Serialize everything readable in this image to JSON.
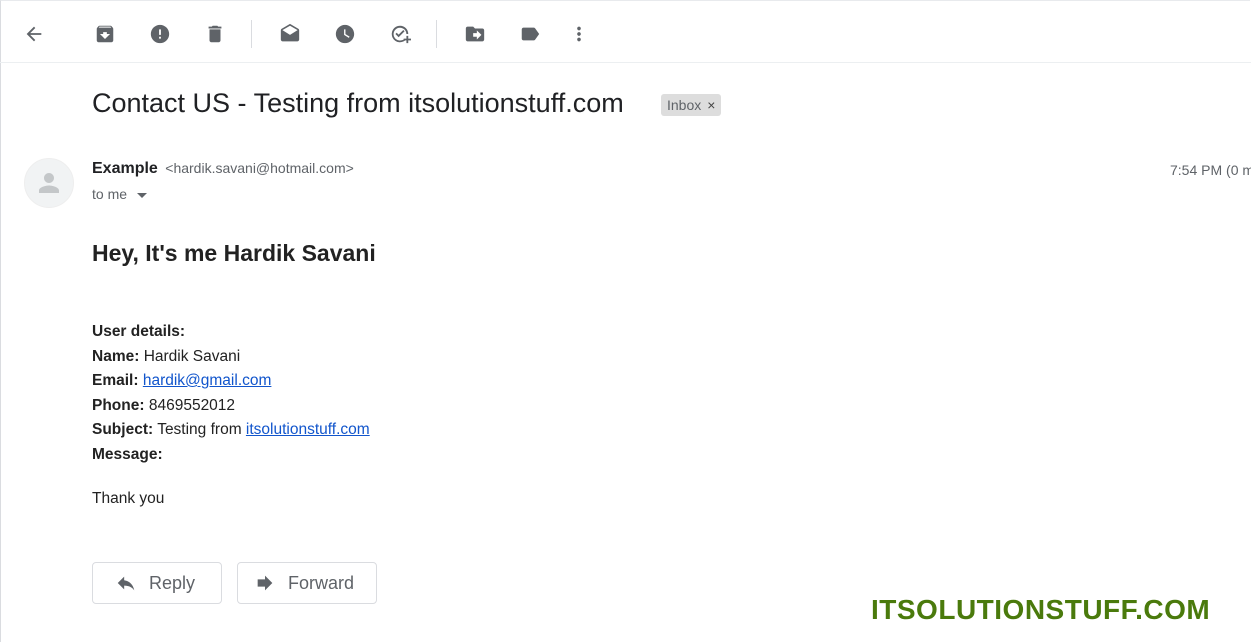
{
  "toolbar": {
    "back": "back-icon",
    "archive": "archive-icon",
    "spam": "report-spam-icon",
    "delete": "delete-icon",
    "mark_unread": "mark-unread-icon",
    "snooze": "snooze-icon",
    "add_task": "add-task-icon",
    "move_to": "move-to-icon",
    "label": "label-icon",
    "more": "more-icon"
  },
  "email": {
    "subject": "Contact US - Testing from itsolutionstuff.com",
    "label_chip": "Inbox",
    "label_chip_close": "×",
    "sender_name": "Example",
    "sender_email": "<hardik.savani@hotmail.com>",
    "recipient": "to me",
    "timestamp": "7:54 PM (0 m"
  },
  "body": {
    "heading": "Hey, It's me Hardik Savani",
    "details_title": "User details:",
    "name_label": "Name:",
    "name_value": "Hardik Savani",
    "email_label": "Email:",
    "email_value": "hardik@gmail.com",
    "phone_label": "Phone:",
    "phone_value": "8469552012",
    "subject_label": "Subject:",
    "subject_prefix": "Testing from",
    "subject_link": "itsolutionstuff.com",
    "message_label": "Message:",
    "thanks": "Thank you"
  },
  "actions": {
    "reply": "Reply",
    "forward": "Forward"
  },
  "watermark": "ITSOLUTIONSTUFF.COM",
  "colors": {
    "link": "#1155cc",
    "watermark": "#4a7a0c",
    "icon": "#5f6368"
  }
}
